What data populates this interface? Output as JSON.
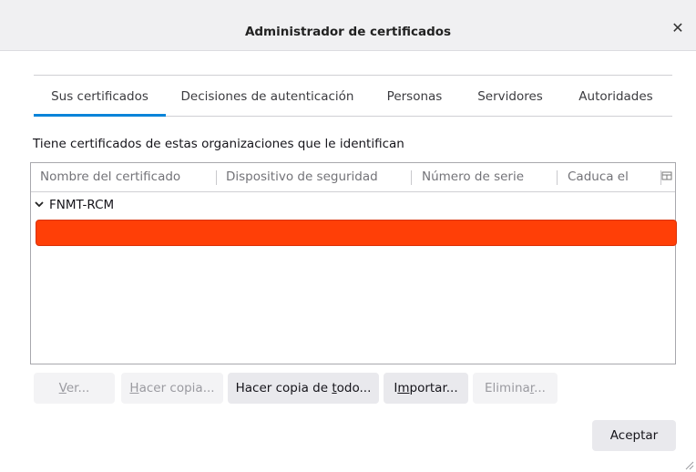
{
  "window": {
    "title": "Administrador de certificados"
  },
  "tabs": [
    {
      "label": "Sus certificados",
      "active": true
    },
    {
      "label": "Decisiones de autenticación"
    },
    {
      "label": "Personas"
    },
    {
      "label": "Servidores"
    },
    {
      "label": "Autoridades"
    }
  ],
  "intro_text": "Tiene certificados de estas organizaciones que le identifican",
  "table": {
    "columns": [
      "Nombre del certificado",
      "Dispositivo de seguridad",
      "Número de serie",
      "Caduca el"
    ],
    "groups": [
      {
        "name": "FNMT-RCM",
        "expanded": true
      }
    ],
    "selected_row_color": "#ff3f07"
  },
  "buttons": {
    "view": {
      "pre": "",
      "key": "V",
      "post": "er..."
    },
    "backup": {
      "pre": "",
      "key": "H",
      "post": "acer copia..."
    },
    "backup_all": {
      "pre": "Hacer copia de ",
      "key": "t",
      "post": "odo..."
    },
    "import": {
      "pre": "I",
      "key": "m",
      "post": "portar..."
    },
    "delete": {
      "pre": "Elimina",
      "key": "r",
      "post": "..."
    },
    "ok": "Aceptar"
  },
  "colors": {
    "accent": "#0a84d9",
    "titlebar_bg": "#f0f0f2",
    "button_bg": "#e9e9ed"
  },
  "icons": {
    "close": "close-icon",
    "twisty": "chevron-down-icon",
    "column_picker": "column-picker-icon"
  }
}
